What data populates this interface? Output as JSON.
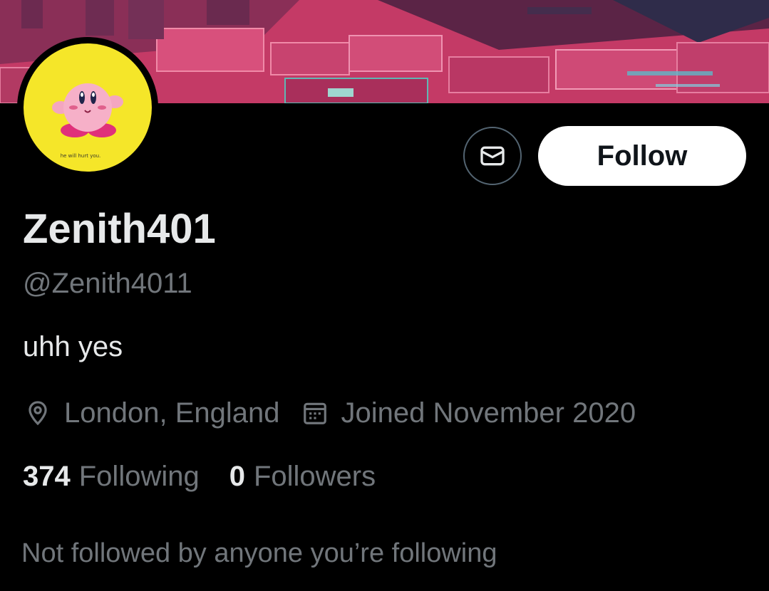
{
  "profile": {
    "display_name": "Zenith401",
    "handle": "@Zenith4011",
    "bio": "uhh yes",
    "location": "London, England",
    "joined": "Joined November 2020",
    "avatar_caption": "he will hurt you."
  },
  "stats": {
    "following_count": "374",
    "following_label": "Following",
    "followers_count": "0",
    "followers_label": "Followers"
  },
  "actions": {
    "follow_label": "Follow"
  },
  "mutuals_text": "Not followed by anyone you’re following",
  "icons": {
    "message": "envelope-icon",
    "location": "location-pin-icon",
    "joined": "calendar-icon"
  },
  "colors": {
    "background": "#000000",
    "primary_text": "#e7e9ea",
    "secondary_text": "#71767b",
    "follow_button_bg": "#ffffff",
    "avatar_bg": "#f5e629",
    "banner_accent": "#d94874"
  }
}
